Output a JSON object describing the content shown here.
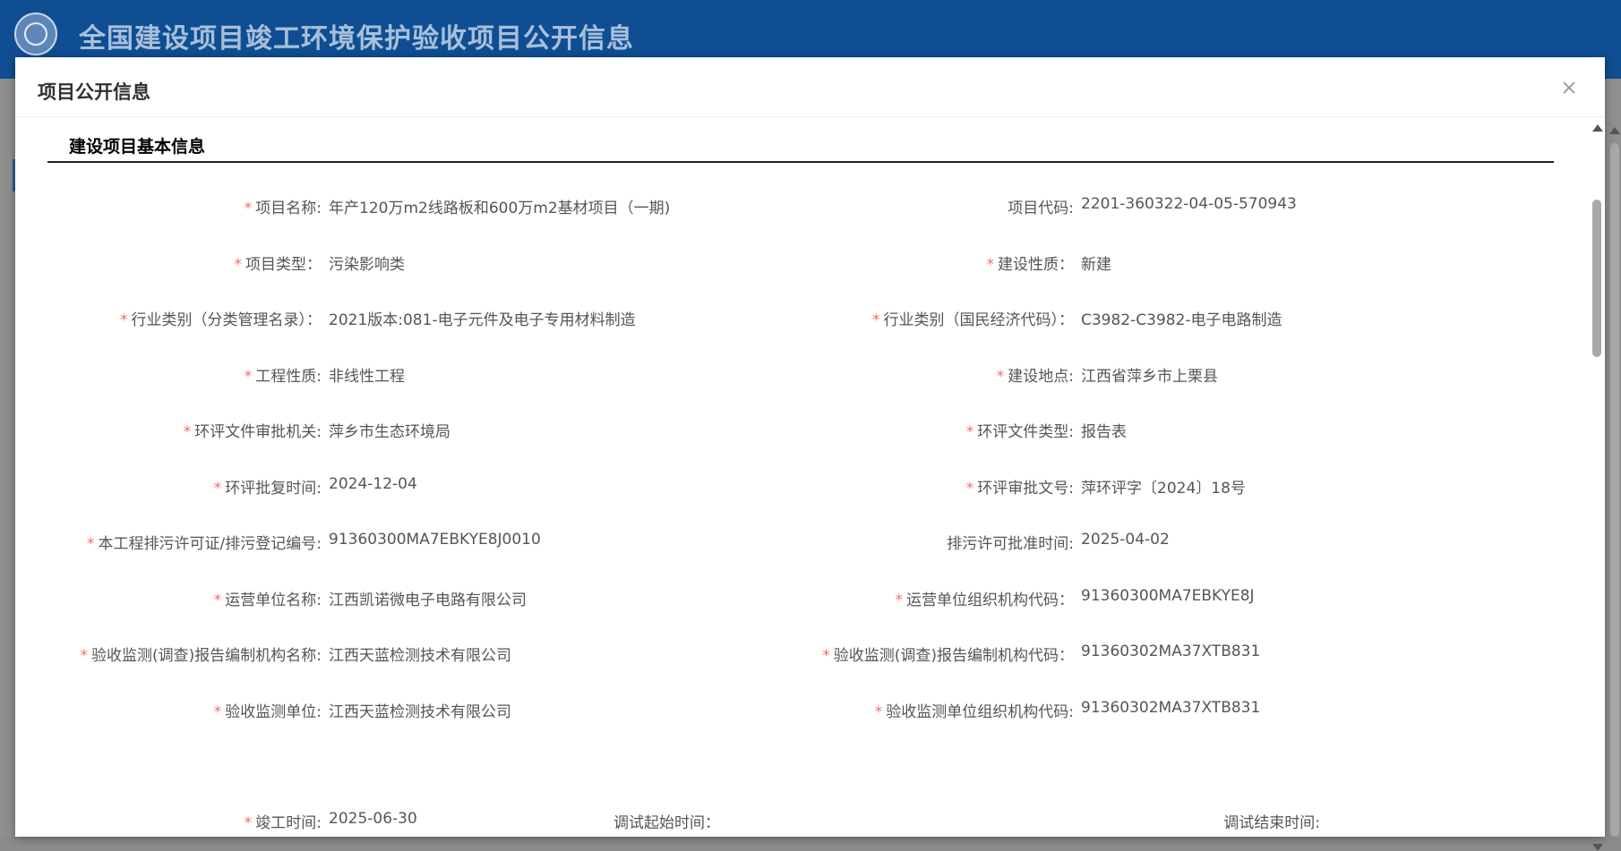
{
  "site": {
    "title": "全国建设项目竣工环境保护验收项目公开信息"
  },
  "dialog": {
    "title": "项目公开信息",
    "section_title": "建设项目基本信息"
  },
  "rows": [
    {
      "left_label": "项目名称:",
      "left_required": true,
      "left_value": "年产120万m2线路板和600万m2基材项目（一期)",
      "right_label": "项目代码:",
      "right_required": false,
      "right_value": "2201-360322-04-05-570943"
    },
    {
      "left_label": "项目类型：",
      "left_required": true,
      "left_value": "污染影响类",
      "right_label": "建设性质：",
      "right_required": true,
      "right_value": "新建"
    },
    {
      "left_label": "行业类别（分类管理名录）：",
      "left_required": true,
      "left_value": "2021版本:081-电子元件及电子专用材料制造",
      "right_label": "行业类别（国民经济代码）：",
      "right_required": true,
      "right_value": "C3982-C3982-电子电路制造"
    },
    {
      "left_label": "工程性质:",
      "left_required": true,
      "left_value": "非线性工程",
      "right_label": "建设地点:",
      "right_required": true,
      "right_value": "江西省萍乡市上栗县"
    },
    {
      "left_label": "环评文件审批机关:",
      "left_required": true,
      "left_value": "萍乡市生态环境局",
      "right_label": "环评文件类型:",
      "right_required": true,
      "right_value": "报告表"
    },
    {
      "left_label": "环评批复时间:",
      "left_required": true,
      "left_value": "2024-12-04",
      "right_label": "环评审批文号:",
      "right_required": true,
      "right_value": "萍环评字〔2024〕18号"
    },
    {
      "left_label": "本工程排污许可证/排污登记编号:",
      "left_required": true,
      "left_value": "91360300MA7EBKYE8J0010",
      "right_label": "排污许可批准时间:",
      "right_required": false,
      "right_value": "2025-04-02"
    },
    {
      "left_label": "运营单位名称:",
      "left_required": true,
      "left_value": "江西凯诺微电子电路有限公司",
      "right_label": "运营单位组织机构代码：",
      "right_required": true,
      "right_value": "91360300MA7EBKYE8J"
    },
    {
      "left_label": "验收监测(调查)报告编制机构名称:",
      "left_required": true,
      "left_value": "江西天蓝检测技术有限公司",
      "right_label": "验收监测(调查)报告编制机构代码：",
      "right_required": true,
      "right_value": "91360302MA37XTB831"
    },
    {
      "left_label": "验收监测单位:",
      "left_required": true,
      "left_value": "江西天蓝检测技术有限公司",
      "right_label": "验收监测单位组织机构代码:",
      "right_required": true,
      "right_value": "91360302MA37XTB831"
    }
  ],
  "last_row": {
    "completion_label": "竣工时间:",
    "completion_value": "2025-06-30",
    "debug_start_label": "调试起始时间：",
    "debug_end_label": "调试结束时间:"
  },
  "icons": {
    "close": "close-icon",
    "emblem": "emblem-logo"
  },
  "colors": {
    "header_bg": "#0f4e92",
    "required_star": "#f56c6c"
  }
}
